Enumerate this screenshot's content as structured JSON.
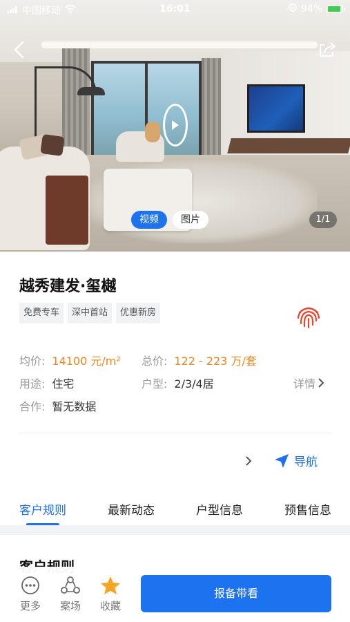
{
  "status_bar": {
    "carrier": "中国移动",
    "time": "16:01",
    "battery": "94%",
    "battery_level": 0.94
  },
  "hero": {
    "media_tabs": [
      {
        "label": "视频",
        "active": true
      },
      {
        "label": "图片",
        "active": false
      }
    ],
    "counter": "1/1",
    "icons": {
      "back": "back-arrow-icon",
      "share": "share-icon",
      "play": "play-icon"
    }
  },
  "project": {
    "title": "越秀建发·玺樾",
    "tags": [
      "免费专车",
      "深中首站",
      "优惠新房"
    ],
    "avg_price_label": "均价:",
    "avg_price_value": "14100 元/m²",
    "total_price_label": "总价:",
    "total_price_value": "122 - 223 万/套",
    "usage_label": "用途:",
    "usage_value": "住宅",
    "layout_label": "户型:",
    "layout_value": "2/3/4居",
    "coop_label": "合作:",
    "coop_value": "暂无数据",
    "detail_label": "详情",
    "nav_label": "导航"
  },
  "tabs": [
    {
      "label": "客户规则",
      "active": true
    },
    {
      "label": "最新动态",
      "active": false
    },
    {
      "label": "户型信息",
      "active": false
    },
    {
      "label": "预售信息",
      "active": false
    }
  ],
  "section_title": "客户规则",
  "bottom_bar": {
    "more": "更多",
    "site": "案场",
    "favorite": "收藏",
    "report_button": "报备带看"
  },
  "colors": {
    "accent": "#1d72f0",
    "price": "#f0851e",
    "fingerprint": "#e8452c",
    "favorite_star": "#f5a623"
  }
}
